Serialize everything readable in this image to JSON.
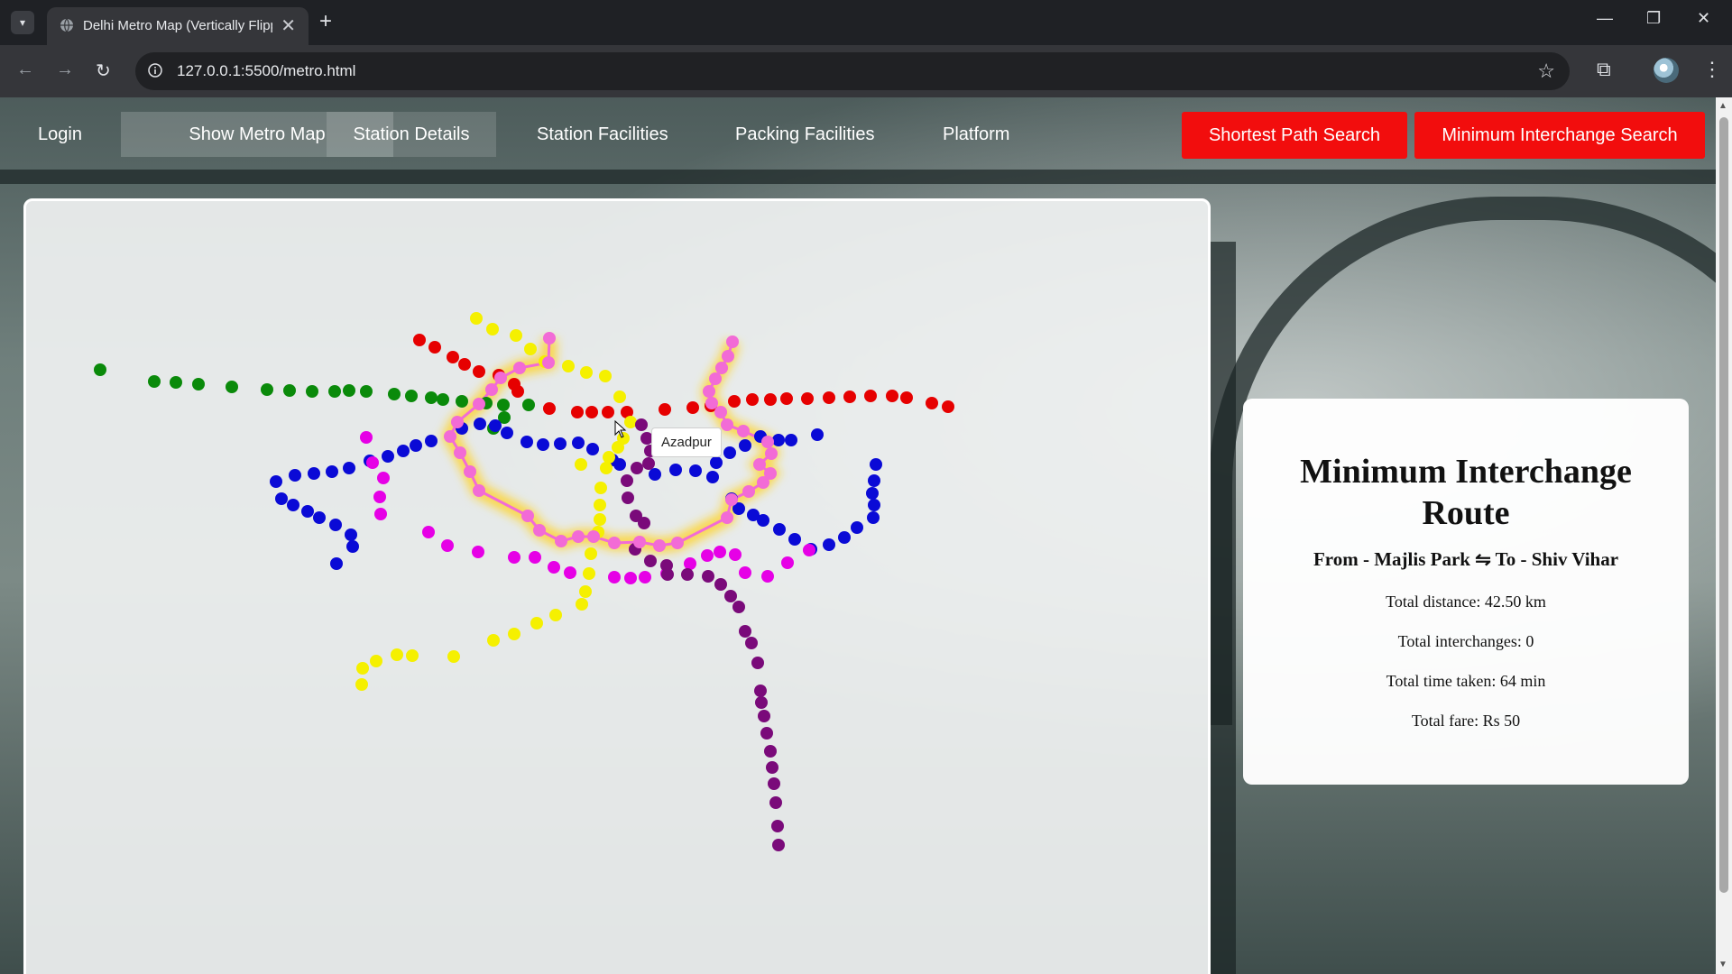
{
  "browser": {
    "tab_title": "Delhi Metro Map (Vertically Flipped)",
    "url": "127.0.0.1:5500/metro.html",
    "new_tab_symbol": "+",
    "close_symbol": "✕"
  },
  "icons": {
    "tab_menu": "chevron-down-icon",
    "back": "arrow-left-icon",
    "forward": "arrow-right-icon",
    "reload": "reload-icon",
    "site_info": "info-icon",
    "bookmark": "star-icon",
    "extensions": "puzzle-icon",
    "profile": "avatar-icon",
    "more": "kebab-menu-icon"
  },
  "nav": {
    "login": "Login",
    "show_map": "Show Metro Map",
    "station_details": "Station Details",
    "station_facilities": "Station Facilities",
    "packing_facilities": "Packing Facilities",
    "platform": "Platform",
    "shortest_path": "Shortest Path Search",
    "min_interchange": "Minimum Interchange Search"
  },
  "map": {
    "tooltip": "Azadpur",
    "colors": {
      "green": "#0a8a0a",
      "red": "#e60000",
      "blue": "#0a0ad6",
      "yellow": "#f5f000",
      "magenta": "#e600e6",
      "purple": "#7a0a7a",
      "pink_route": "#f26bd6",
      "glow": "#ffd21f"
    }
  },
  "result": {
    "heading": "Minimum Interchange Route",
    "route": "From - Majlis Park ⇋ To - Shiv Vihar",
    "distance": "Total distance: 42.50 km",
    "interchanges": "Total interchanges: 0",
    "time": "Total time taken: 64 min",
    "fare": "Total fare: Rs 50"
  }
}
